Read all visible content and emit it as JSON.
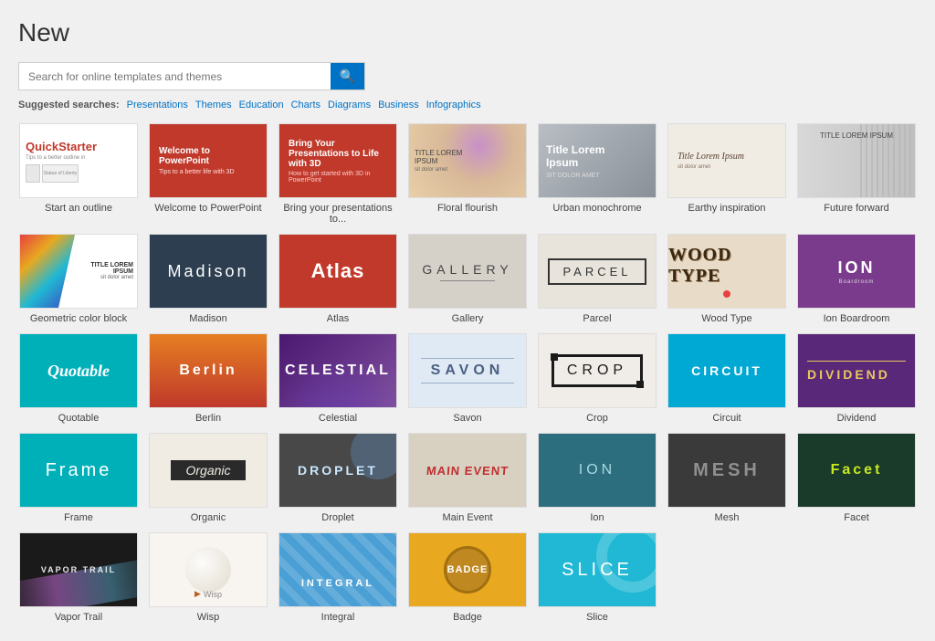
{
  "page": {
    "title": "New",
    "search_placeholder": "Search for online templates and themes",
    "search_icon": "🔍",
    "suggested_label": "Suggested searches:",
    "suggestions": [
      "Presentations",
      "Themes",
      "Education",
      "Charts",
      "Diagrams",
      "Business",
      "Infographics"
    ]
  },
  "templates": [
    {
      "id": "quickstarter",
      "label": "Start an outline",
      "style": "quickstarter"
    },
    {
      "id": "welcome",
      "label": "Welcome to PowerPoint",
      "style": "welcome"
    },
    {
      "id": "bring",
      "label": "Bring your presentations to...",
      "style": "bring"
    },
    {
      "id": "floral",
      "label": "Floral flourish",
      "style": "floral"
    },
    {
      "id": "urban",
      "label": "Urban monochrome",
      "style": "urban"
    },
    {
      "id": "earthy",
      "label": "Earthy inspiration",
      "style": "earthy"
    },
    {
      "id": "future",
      "label": "Future forward",
      "style": "future"
    },
    {
      "id": "geometric",
      "label": "Geometric color block",
      "style": "geometric"
    },
    {
      "id": "madison",
      "label": "Madison",
      "style": "madison"
    },
    {
      "id": "atlas",
      "label": "Atlas",
      "style": "atlas"
    },
    {
      "id": "gallery",
      "label": "Gallery",
      "style": "gallery"
    },
    {
      "id": "parcel",
      "label": "Parcel",
      "style": "parcel"
    },
    {
      "id": "woodtype",
      "label": "Wood Type",
      "style": "woodtype"
    },
    {
      "id": "ionboardroom",
      "label": "Ion Boardroom",
      "style": "ionboardroom"
    },
    {
      "id": "quotable",
      "label": "Quotable",
      "style": "quotable"
    },
    {
      "id": "berlin",
      "label": "Berlin",
      "style": "berlin"
    },
    {
      "id": "celestial",
      "label": "Celestial",
      "style": "celestial"
    },
    {
      "id": "savon",
      "label": "Savon",
      "style": "savon"
    },
    {
      "id": "crop",
      "label": "Crop",
      "style": "crop"
    },
    {
      "id": "circuit",
      "label": "Circuit",
      "style": "circuit"
    },
    {
      "id": "dividend",
      "label": "Dividend",
      "style": "dividend"
    },
    {
      "id": "frame",
      "label": "Frame",
      "style": "frame"
    },
    {
      "id": "organic",
      "label": "Organic",
      "style": "organic"
    },
    {
      "id": "droplet",
      "label": "Droplet",
      "style": "droplet"
    },
    {
      "id": "mainevent",
      "label": "Main Event",
      "style": "mainevent"
    },
    {
      "id": "ion2",
      "label": "Ion",
      "style": "ion2"
    },
    {
      "id": "mesh",
      "label": "Mesh",
      "style": "mesh"
    },
    {
      "id": "facet",
      "label": "Facet",
      "style": "facet"
    },
    {
      "id": "vaportrail",
      "label": "Vapor Trail",
      "style": "vaportrail"
    },
    {
      "id": "wisp",
      "label": "Wisp",
      "style": "wisp"
    },
    {
      "id": "integral",
      "label": "Integral",
      "style": "integral"
    },
    {
      "id": "badge",
      "label": "Badge",
      "style": "badge"
    },
    {
      "id": "slice",
      "label": "Slice",
      "style": "slice"
    }
  ]
}
